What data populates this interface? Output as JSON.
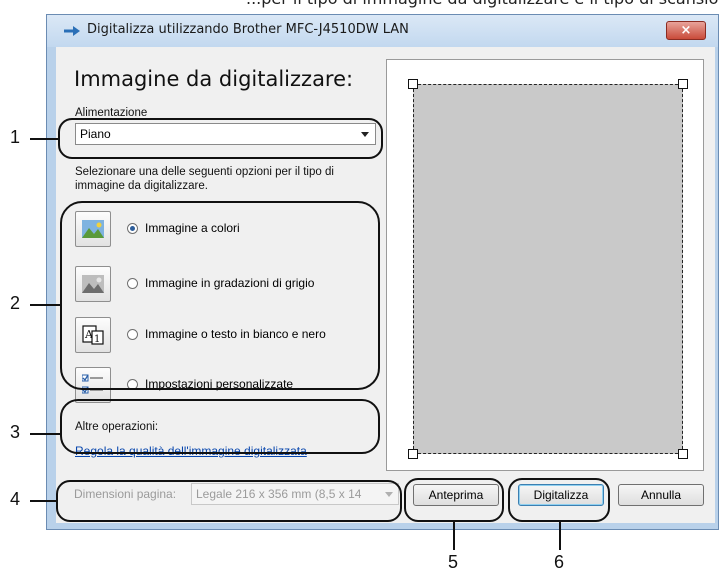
{
  "manual_text": "...per il tipo di immagine da digitalizzare e il tipo di scansione, e poi",
  "window": {
    "title": "Digitalizza utilizzando Brother MFC-J4510DW LAN",
    "close_label": "×"
  },
  "heading": "Immagine da digitalizzare:",
  "source": {
    "label": "Alimentazione",
    "value": "Piano"
  },
  "instructions": "Selezionare una delle seguenti opzioni per il tipo di immagine da digitalizzare.",
  "scan_types": [
    {
      "label": "Immagine a colori",
      "selected": true,
      "icon": "color-photo-icon"
    },
    {
      "label": "Immagine in gradazioni di grigio",
      "selected": false,
      "icon": "grayscale-photo-icon"
    },
    {
      "label": "Immagine o testo in bianco e nero",
      "selected": false,
      "icon": "bw-text-icon"
    },
    {
      "label": "Impostazioni personalizzate",
      "selected": false,
      "icon": "custom-settings-icon"
    }
  ],
  "other_operations": {
    "label": "Altre operazioni:",
    "link": "Regola la qualità dell'immagine digitalizzata"
  },
  "page_size": {
    "label": "Dimensioni pagina:",
    "value": "Legale 216 x 356 mm (8,5 x 14"
  },
  "buttons": {
    "preview": "Anteprima",
    "scan": "Digitalizza",
    "cancel": "Annulla"
  },
  "callouts": [
    "1",
    "2",
    "3",
    "4",
    "5",
    "6"
  ],
  "colors": {
    "title_bar": "#c2d8ef",
    "close_button": "#c94b3a",
    "preview_page": "#c9c9c9",
    "link": "#0645ad"
  }
}
